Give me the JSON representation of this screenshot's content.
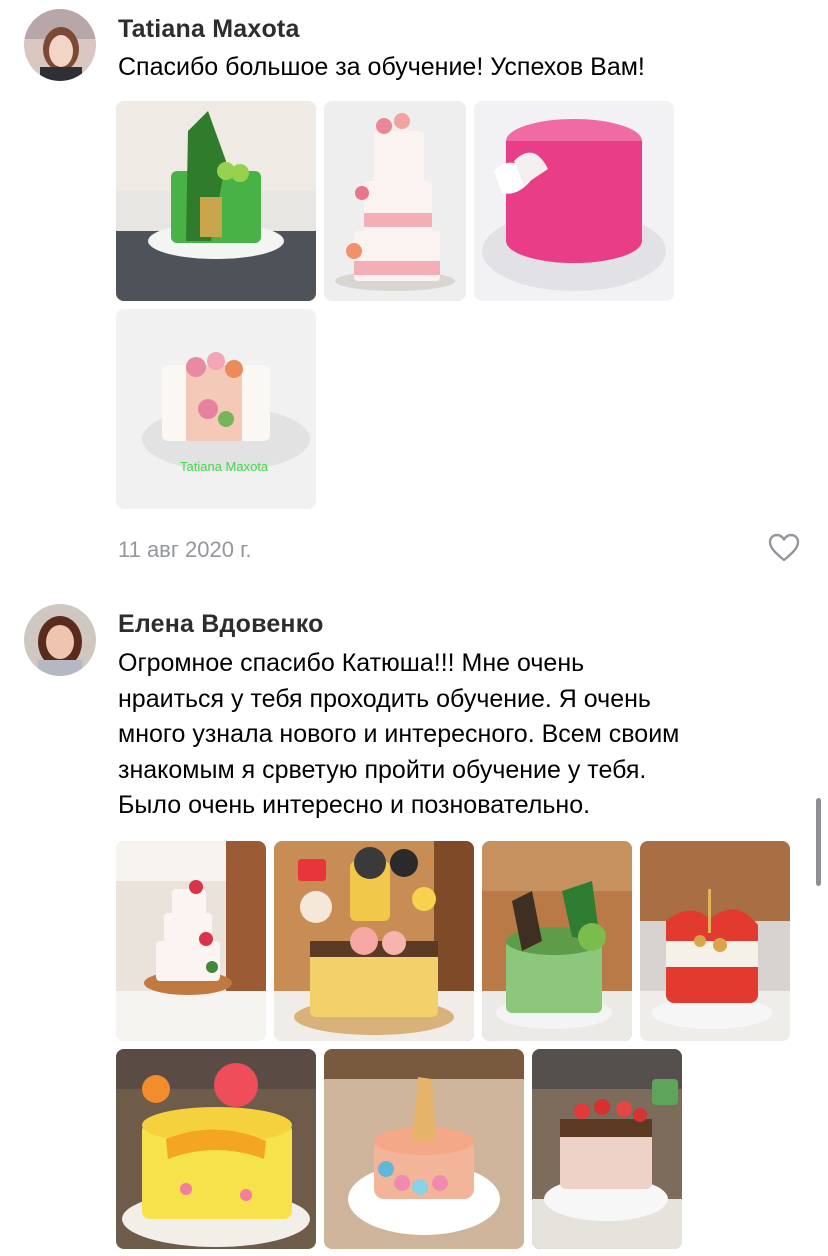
{
  "comments": [
    {
      "author": "Tatiana Maxota",
      "text": "Спасибо большое за обучение!  Успехов Вам!",
      "date": "11 авг 2020 г.",
      "photos": [
        {
          "subject": "green cake with chocolate bark and macarons, coffee wall background"
        },
        {
          "subject": "three-tier white cake with pink roses"
        },
        {
          "subject": "pink mirror glaze cake with white flower"
        },
        {
          "subject": "white cake with buttercream flowers, watermark",
          "watermark": "Tatiana Maxota"
        }
      ]
    },
    {
      "author": "Елена Вдовенко",
      "text_lines": [
        "Огромное спасибо Катюша!!! Мне очень",
        "нраиться у тебя проходить обучение. Я очень",
        "много узнала нового и интересного. Всем своим",
        "знакомым я срветую пройти обучение у тебя.",
        "Было очень интересно и позновательно."
      ],
      "photos": [
        {
          "subject": "three-tier white cake with red flowers"
        },
        {
          "subject": "yellow drip cake with lollipops and cartoon topper"
        },
        {
          "subject": "green moss cake with chocolate trees"
        },
        {
          "subject": "red and white cake with gold spheres"
        },
        {
          "subject": "yellow cake with sugar flowers and lettering"
        },
        {
          "subject": "unicorn cake with ice cream cone horn"
        },
        {
          "subject": "drip cake with strawberries"
        }
      ]
    }
  ],
  "icons": {
    "like": "heart-outline-icon"
  },
  "colors": {
    "author": "#2c2d2e",
    "date": "#93969b",
    "like": "#93969b"
  }
}
